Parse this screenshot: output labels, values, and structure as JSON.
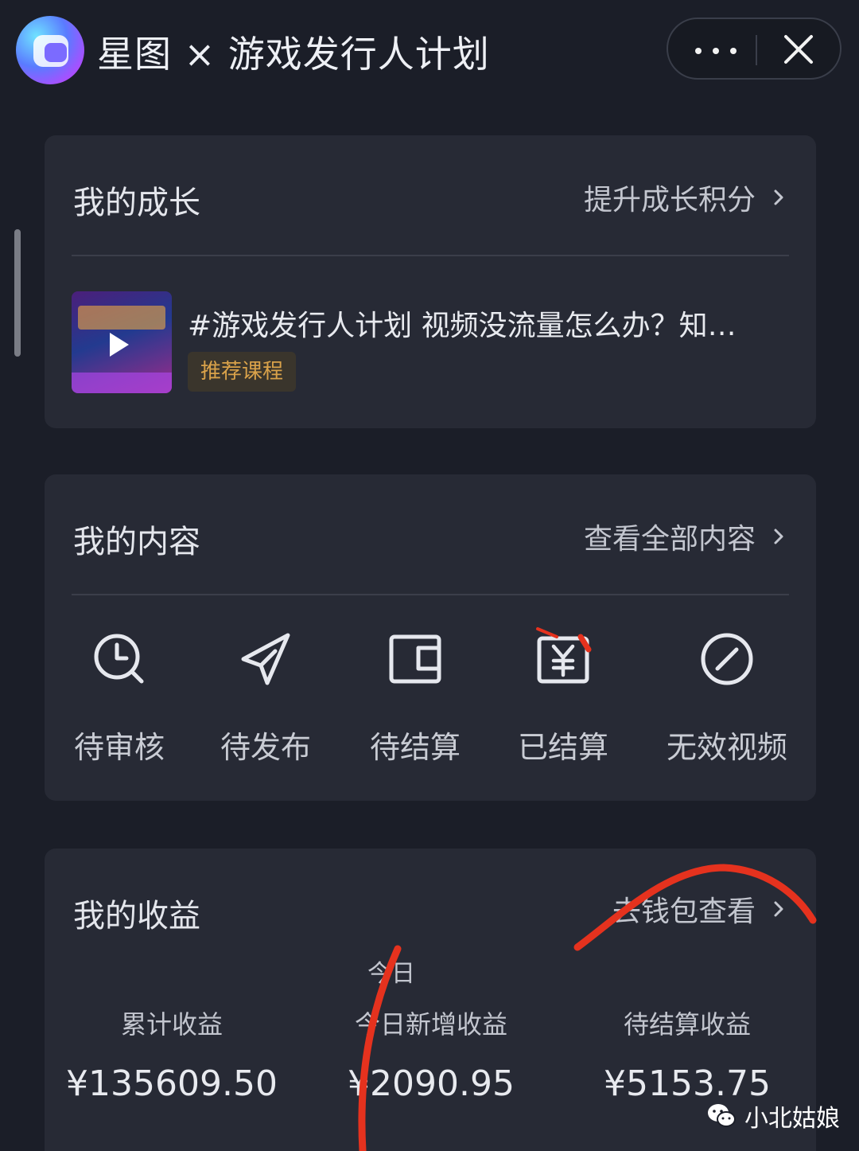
{
  "header": {
    "title": "星图 × 游戏发行人计划",
    "more_icon": "more-dots-icon",
    "close_icon": "close-icon"
  },
  "growth": {
    "title": "我的成长",
    "link": "提升成长积分",
    "course": {
      "title": "#游戏发行人计划 视频没流量怎么办？知…",
      "tag": "推荐课程"
    }
  },
  "content": {
    "title": "我的内容",
    "link": "查看全部内容",
    "statuses": [
      {
        "label": "待审核",
        "icon": "clock-search-icon"
      },
      {
        "label": "待发布",
        "icon": "send-plane-icon"
      },
      {
        "label": "待结算",
        "icon": "wallet-icon"
      },
      {
        "label": "已结算",
        "icon": "yen-receipt-icon"
      },
      {
        "label": "无效视频",
        "icon": "prohibited-icon"
      }
    ]
  },
  "earnings": {
    "title": "我的收益",
    "link": "去钱包查看",
    "period": "今日",
    "stats": [
      {
        "label": "累计收益",
        "value": "¥135609.50"
      },
      {
        "label": "今日新增收益",
        "value": "¥2090.95"
      },
      {
        "label": "待结算收益",
        "value": "¥5153.75"
      }
    ]
  },
  "watermark": {
    "text": "小北姑娘",
    "icon": "wechat-icon"
  },
  "colors": {
    "background": "#1b1e28",
    "card": "#272a35",
    "tag_text": "#d9a24a",
    "annotation_red": "#e5321e"
  }
}
